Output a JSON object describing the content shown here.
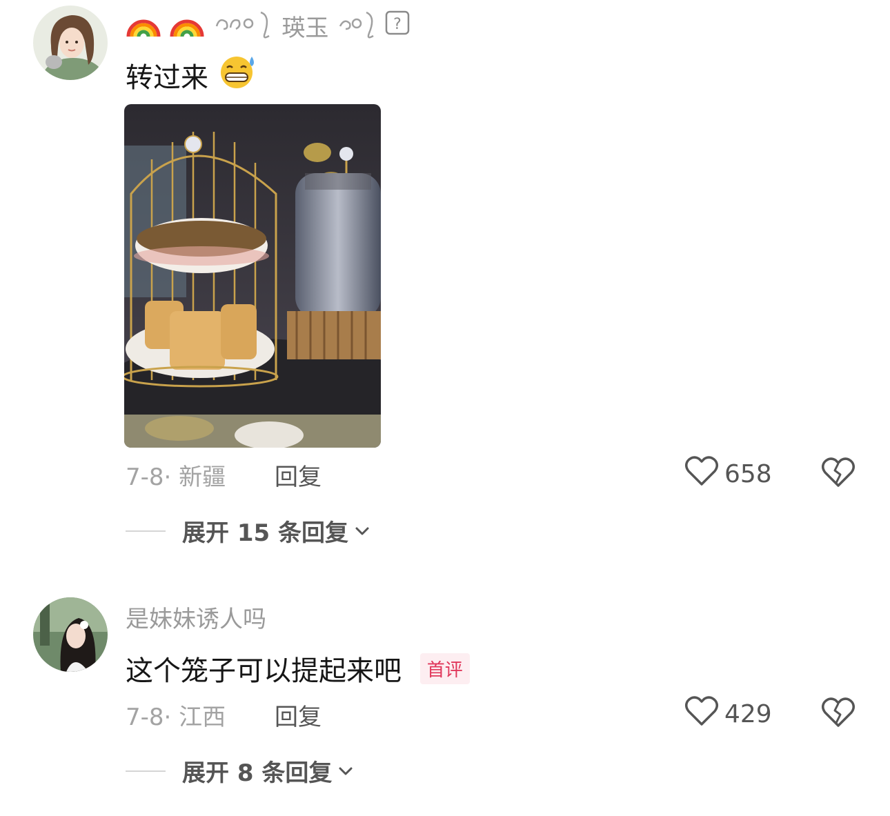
{
  "comments": [
    {
      "username": "瑛玉",
      "text": "转过来",
      "date_location": "7-8· 新疆",
      "reply_label": "回复",
      "likes": "658",
      "expand_label": "展开 15 条回复"
    },
    {
      "username": "是妹妹诱人吗",
      "text": "这个笼子可以提起来吧",
      "badge": "首评",
      "date_location": "7-8· 江西",
      "reply_label": "回复",
      "likes": "429",
      "expand_label": "展开 8 条回复"
    }
  ],
  "colors": {
    "badge_text": "#e0365a",
    "badge_bg": "#fdeef1",
    "meta_gray": "#a3a3a3"
  }
}
